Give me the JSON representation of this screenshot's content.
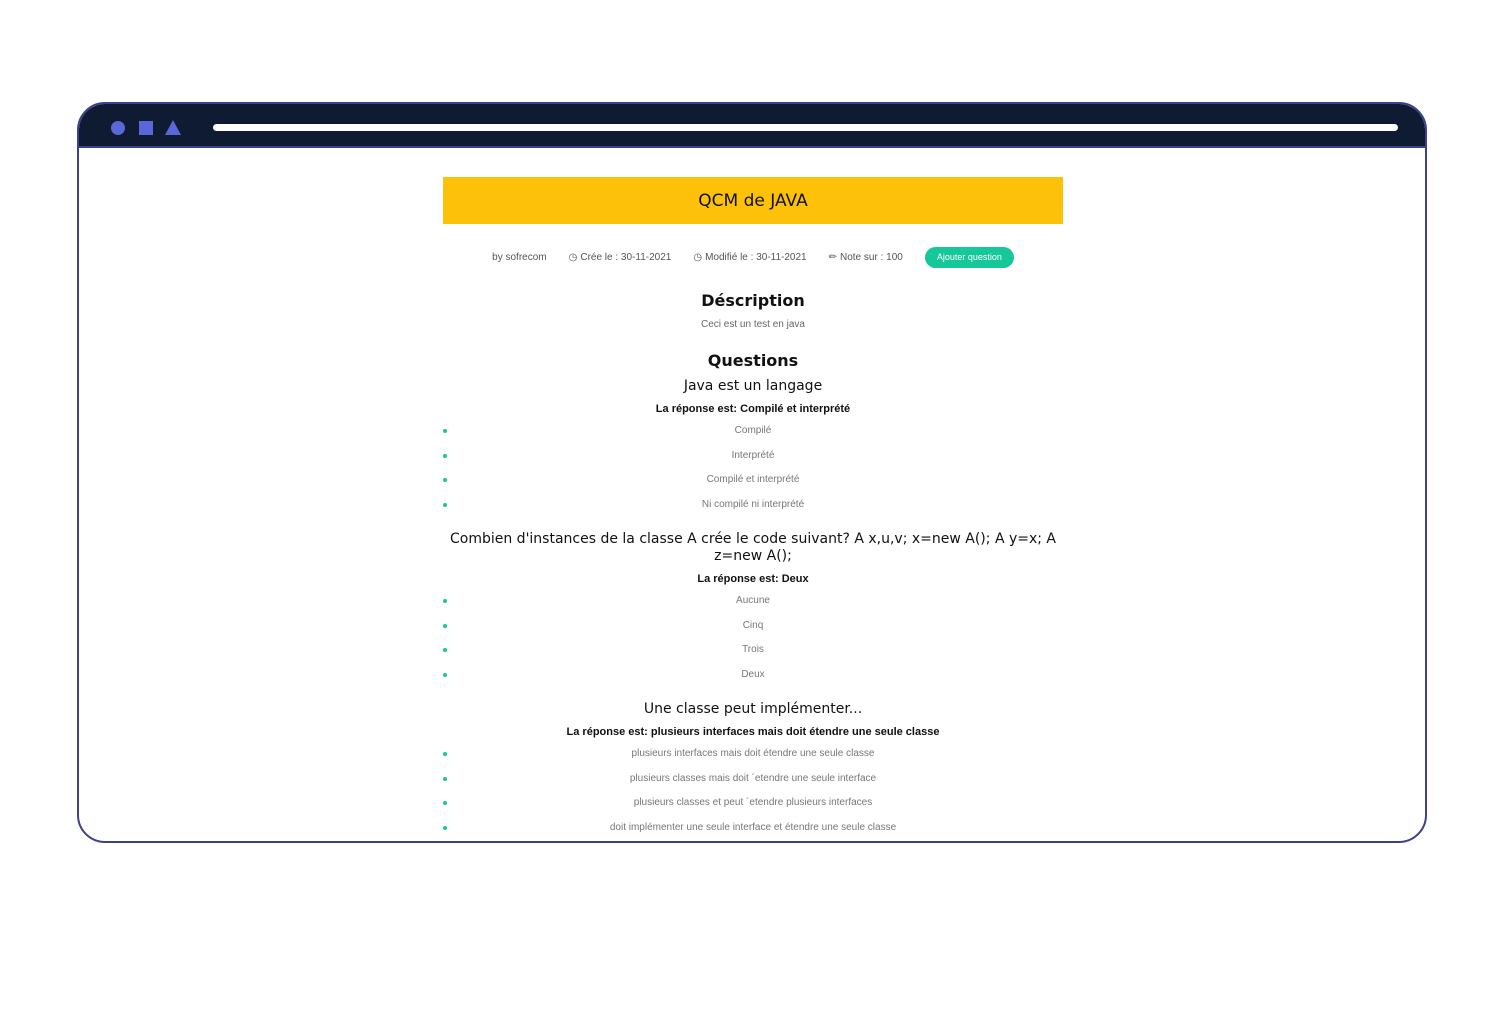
{
  "header": {
    "title": "QCM de JAVA"
  },
  "meta": {
    "author": "by sofrecom",
    "created": "Crée le : 30-11-2021",
    "modified": "Modifié le : 30-11-2021",
    "note": "Note sur : 100",
    "add_button": "Ajouter question",
    "icons": {
      "created": "clock-icon",
      "modified": "clock-icon",
      "note": "pencil-icon"
    }
  },
  "description": {
    "title": "Déscription",
    "text": "Ceci est un test en java"
  },
  "questions_title": "Questions",
  "questions": [
    {
      "text": "Java est un langage",
      "answer": "La réponse est: Compilé et interprété",
      "options": [
        "Compilé",
        "Interprété",
        "Compilé et interprété",
        "Ni compilé ni interprété"
      ]
    },
    {
      "text": "Combien d'instances de la classe A crée le code suivant? A x,u,v; x=new A(); A y=x; A z=new A();",
      "answer": "La réponse est: Deux",
      "options": [
        "Aucune",
        "Cinq",
        "Trois",
        "Deux"
      ]
    },
    {
      "text": "Une classe peut implémenter...",
      "answer": "La réponse est: plusieurs interfaces mais doit étendre une seule classe",
      "options": [
        "plusieurs interfaces mais doit étendre une seule classe",
        "plusieurs classes mais doit ´etendre une seule interface",
        "plusieurs classes et peut ´etendre plusieurs interfaces",
        "doit implémenter une seule interface et étendre une seule classe"
      ]
    }
  ],
  "colors": {
    "banner": "#fdc10a",
    "accent": "#16c79a",
    "frame": "#0f1a33"
  }
}
